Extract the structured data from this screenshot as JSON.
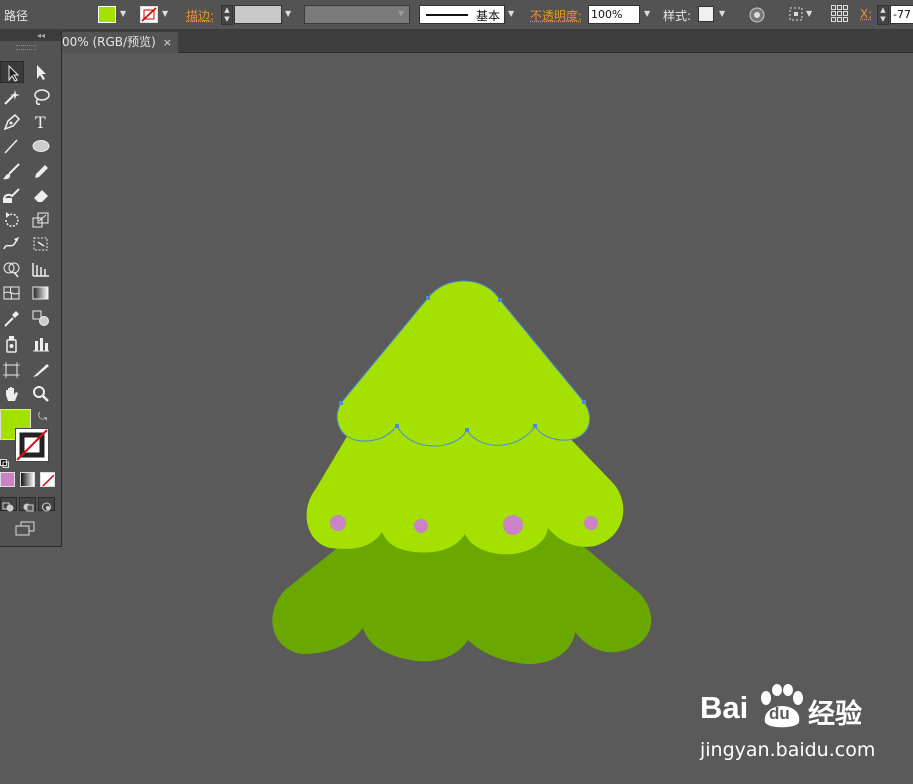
{
  "control_bar": {
    "selection_type": "路径",
    "fill_color": "#a4e000",
    "stroke_label": "描边:",
    "stroke_profile": "基本",
    "opacity_label": "不透明度:",
    "opacity_value": "100%",
    "style_label": "样式:",
    "x_label": "X:",
    "x_value": "-77"
  },
  "document_tab": {
    "title": "00% (RGB/预览)",
    "close": "×"
  },
  "tools_panel": {
    "collapse": "◂◂",
    "fill_color": "#a4e000",
    "tools": [
      "selection",
      "direct-selection",
      "magic-wand",
      "lasso",
      "pen",
      "type",
      "line-segment",
      "ellipse",
      "paintbrush",
      "pencil",
      "blob-brush",
      "eraser",
      "rotate",
      "scale",
      "warp",
      "free-transform",
      "shape-builder",
      "graph",
      "mesh",
      "gradient",
      "eyedropper",
      "blend",
      "symbol-sprayer",
      "column-graph",
      "artboard",
      "slice",
      "hand",
      "zoom"
    ]
  },
  "artwork": {
    "colors": {
      "light_green": "#a4e000",
      "dark_green": "#6aa800",
      "ornament": "#c983c6",
      "path_outline": "#4a8cdc"
    }
  },
  "watermark": {
    "brand_bai": "Bai",
    "brand_du": "du",
    "brand_cn": "经验",
    "url": "jingyan.baidu.com"
  }
}
